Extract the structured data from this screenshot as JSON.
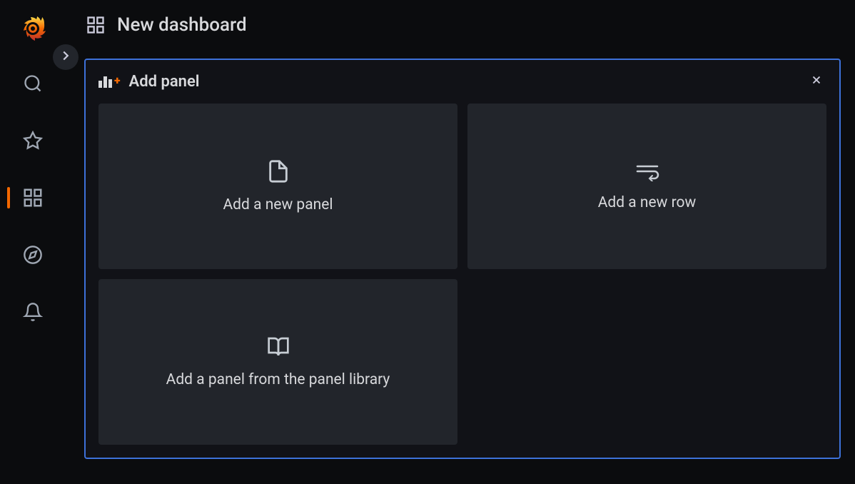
{
  "header": {
    "title": "New dashboard"
  },
  "addPanel": {
    "title": "Add panel",
    "cards": [
      {
        "label": "Add a new panel",
        "icon": "file"
      },
      {
        "label": "Add a new row",
        "icon": "wrap"
      },
      {
        "label": "Add a panel from the panel library",
        "icon": "book"
      }
    ]
  },
  "sidebar": {
    "items": [
      {
        "name": "search",
        "active": false
      },
      {
        "name": "star",
        "active": false
      },
      {
        "name": "dashboards",
        "active": true
      },
      {
        "name": "explore",
        "active": false
      },
      {
        "name": "alerting",
        "active": false
      }
    ]
  }
}
